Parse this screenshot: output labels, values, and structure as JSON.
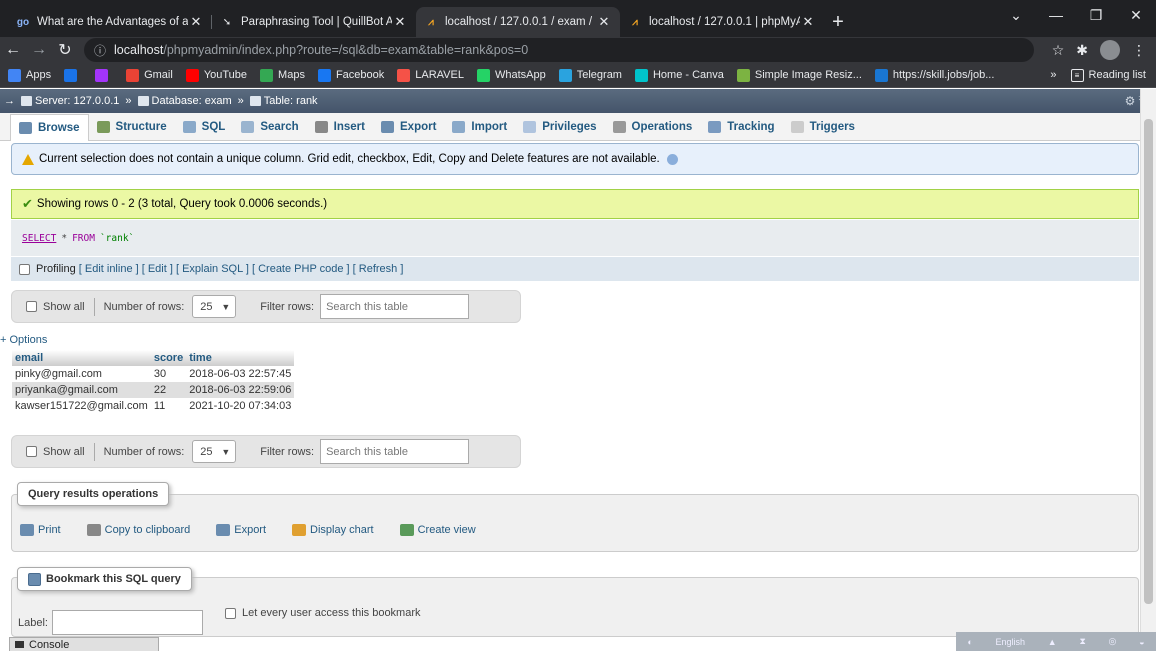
{
  "browser": {
    "tabs": [
      {
        "title": "What are the Advantages of a Da",
        "favicon": "go-icon",
        "active": false
      },
      {
        "title": "Paraphrasing Tool | QuillBot AI",
        "favicon": "quillbot-icon",
        "active": false
      },
      {
        "title": "localhost / 127.0.0.1 / exam / ran",
        "favicon": "phpmyadmin-icon",
        "active": true
      },
      {
        "title": "localhost / 127.0.0.1 | phpMyAdm",
        "favicon": "phpmyadmin-icon",
        "active": false
      }
    ],
    "new_tab": "+",
    "url_host": "localhost",
    "url_path": "/phpmyadmin/index.php?route=/sql&db=exam&table=rank&pos=0",
    "bookmarks": [
      {
        "label": "Apps",
        "icon": "apps-icon",
        "color": "#4285f4"
      },
      {
        "label": "",
        "icon": "bookmark-icon",
        "color": "#1a73e8"
      },
      {
        "label": "",
        "icon": "messenger-icon",
        "color": "#a334fa"
      },
      {
        "label": "Gmail",
        "icon": "gmail-icon",
        "color": "#ea4335"
      },
      {
        "label": "YouTube",
        "icon": "youtube-icon",
        "color": "#ff0000"
      },
      {
        "label": "Maps",
        "icon": "maps-icon",
        "color": "#34a853"
      },
      {
        "label": "Facebook",
        "icon": "facebook-icon",
        "color": "#1877f2"
      },
      {
        "label": "LARAVEL",
        "icon": "laravel-icon",
        "color": "#f55247"
      },
      {
        "label": "WhatsApp",
        "icon": "whatsapp-icon",
        "color": "#25d366"
      },
      {
        "label": "Telegram",
        "icon": "telegram-icon",
        "color": "#2aa3df"
      },
      {
        "label": "Home - Canva",
        "icon": "canva-icon",
        "color": "#00c4cc"
      },
      {
        "label": "Simple Image Resiz...",
        "icon": "resizer-icon",
        "color": "#7cb342"
      },
      {
        "label": "https://skill.jobs/job...",
        "icon": "skilljobs-icon",
        "color": "#1976d2"
      }
    ],
    "more": "»",
    "reading_list": "Reading list"
  },
  "pma": {
    "breadcrumb": {
      "server": "Server: 127.0.0.1",
      "database": "Database: exam",
      "table": "Table: rank",
      "separator": "»"
    },
    "menu": [
      {
        "label": "Browse",
        "icon": "browse-icon",
        "color": "#6a8caf"
      },
      {
        "label": "Structure",
        "icon": "structure-icon",
        "color": "#7a9a5a"
      },
      {
        "label": "SQL",
        "icon": "sql-icon",
        "color": "#8aa9c9"
      },
      {
        "label": "Search",
        "icon": "search-icon",
        "color": "#9ab4cf"
      },
      {
        "label": "Insert",
        "icon": "insert-icon",
        "color": "#888888"
      },
      {
        "label": "Export",
        "icon": "export-icon",
        "color": "#6a8caf"
      },
      {
        "label": "Import",
        "icon": "import-icon",
        "color": "#8aa9c9"
      },
      {
        "label": "Privileges",
        "icon": "privileges-icon",
        "color": "#b0c4de"
      },
      {
        "label": "Operations",
        "icon": "operations-icon",
        "color": "#999999"
      },
      {
        "label": "Tracking",
        "icon": "tracking-icon",
        "color": "#7a9ac0"
      },
      {
        "label": "Triggers",
        "icon": "triggers-icon",
        "color": "#cccccc"
      }
    ],
    "notice": "Current selection does not contain a unique column. Grid edit, checkbox, Edit, Copy and Delete features are not available.",
    "success": "Showing rows 0 - 2 (3 total, Query took 0.0006 seconds.)",
    "sql": {
      "select": "SELECT",
      "star": "*",
      "from": "FROM",
      "table": "`rank`"
    },
    "profiling": {
      "label": "Profiling",
      "links": "[ Edit inline ] [ Edit ] [ Explain SQL ] [ Create PHP code ] [ Refresh ]"
    },
    "nav": {
      "show_all": "Show all",
      "rows_label": "Number of rows:",
      "rows_value": "25",
      "filter_label": "Filter rows:",
      "filter_placeholder": "Search this table"
    },
    "options": "+ Options",
    "table": {
      "headers": [
        "email",
        "score",
        "time"
      ],
      "rows": [
        [
          "pinky@gmail.com",
          "30",
          "2018-06-03 22:57:45"
        ],
        [
          "priyanka@gmail.com",
          "22",
          "2018-06-03 22:59:06"
        ],
        [
          "kawser151722@gmail.com",
          "11",
          "2021-10-20 07:34:03"
        ]
      ]
    },
    "qro": {
      "title": "Query results operations",
      "items": [
        {
          "label": "Print",
          "icon": "print-icon",
          "color": "#6a8caf"
        },
        {
          "label": "Copy to clipboard",
          "icon": "clipboard-icon",
          "color": "#888888"
        },
        {
          "label": "Export",
          "icon": "export-icon",
          "color": "#6a8caf"
        },
        {
          "label": "Display chart",
          "icon": "chart-icon",
          "color": "#e0a030"
        },
        {
          "label": "Create view",
          "icon": "view-icon",
          "color": "#5a9a5a"
        }
      ]
    },
    "bookmark": {
      "title": "Bookmark this SQL query",
      "label": "Label:",
      "share": "Let every user access this bookmark"
    },
    "console": "Console"
  },
  "tray": {
    "lang": "English"
  }
}
